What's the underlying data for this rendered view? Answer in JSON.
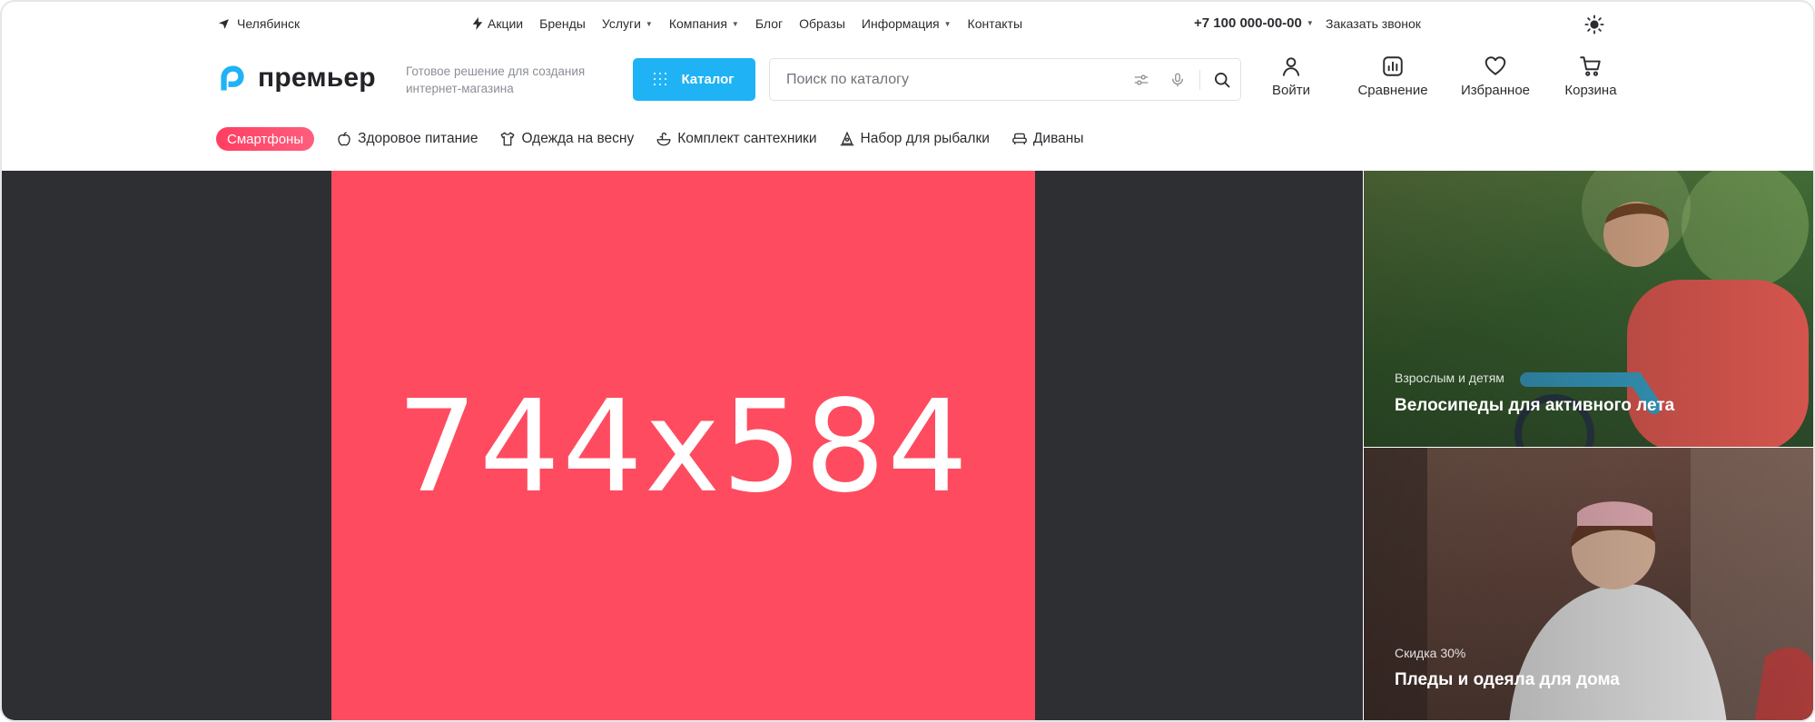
{
  "topbar": {
    "city": "Челябинск",
    "nav": [
      {
        "label": "Акции",
        "dropdown": false,
        "icon": "lightning-icon"
      },
      {
        "label": "Бренды",
        "dropdown": false
      },
      {
        "label": "Услуги",
        "dropdown": true
      },
      {
        "label": "Компания",
        "dropdown": true
      },
      {
        "label": "Блог",
        "dropdown": false
      },
      {
        "label": "Образы",
        "dropdown": false
      },
      {
        "label": "Информация",
        "dropdown": true
      },
      {
        "label": "Контакты",
        "dropdown": false
      }
    ],
    "phone": "+7 100 000-00-00",
    "callback": "Заказать звонок"
  },
  "header": {
    "logo_text": "премьер",
    "tagline": "Готовое решение для создания интернет-магазина",
    "catalog_label": "Каталог",
    "search_placeholder": "Поиск по каталогу",
    "actions": {
      "login": "Войти",
      "compare": "Сравнение",
      "favorites": "Избранное",
      "cart": "Корзина"
    }
  },
  "quick_categories": {
    "highlight": "Смартфоны",
    "items": [
      {
        "label": "Здоровое питание",
        "icon": "apple-icon"
      },
      {
        "label": "Одежда на весну",
        "icon": "tshirt-icon"
      },
      {
        "label": "Комплект сантехники",
        "icon": "faucet-icon"
      },
      {
        "label": "Набор для рыбалки",
        "icon": "fishing-icon"
      },
      {
        "label": "Диваны",
        "icon": "sofa-icon"
      }
    ]
  },
  "hero": {
    "banner_text": "744x584"
  },
  "promos": [
    {
      "tag": "Взрослым и детям",
      "title": "Велосипеды для активного лета"
    },
    {
      "tag": "Скидка 30%",
      "title": "Пледы и одеяла для дома"
    }
  ],
  "colors": {
    "accent": "#1fb3f5",
    "highlight": "#ff4b5f",
    "hero_bg": "#2e2f33"
  }
}
